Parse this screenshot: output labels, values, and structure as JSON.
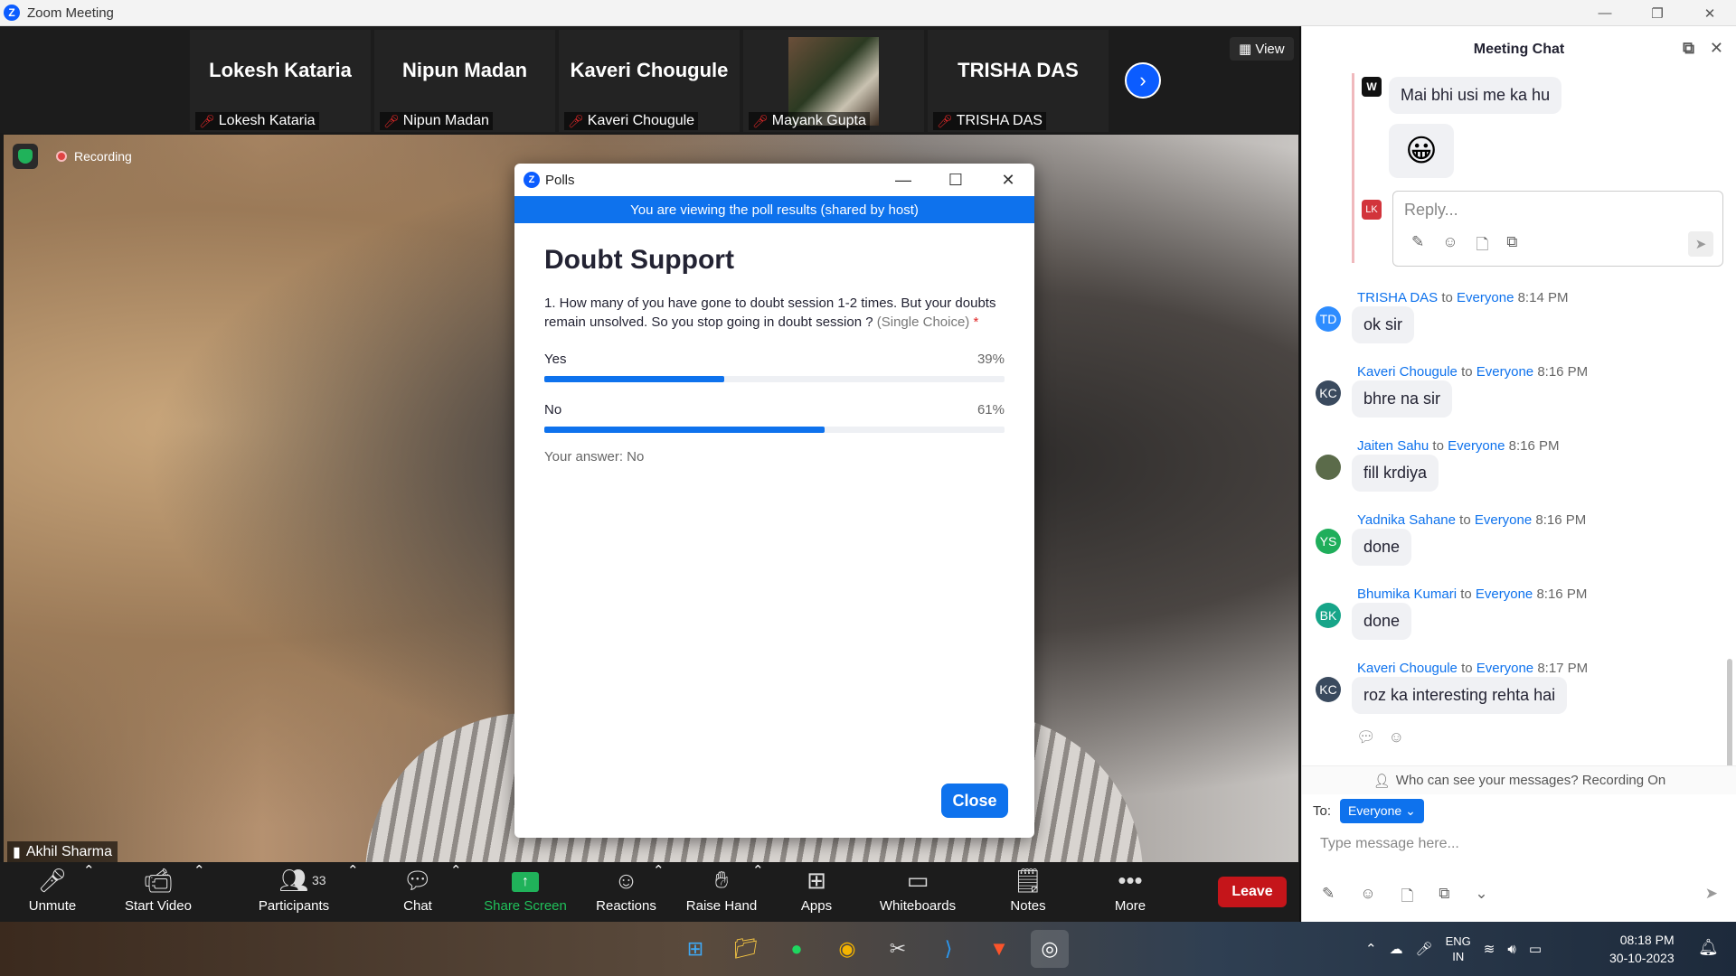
{
  "window": {
    "title": "Zoom Meeting"
  },
  "participants_strip": [
    {
      "big_name": "Lokesh Kataria",
      "label": "Lokesh Kataria"
    },
    {
      "big_name": "Nipun Madan",
      "label": "Nipun Madan"
    },
    {
      "big_name": "Kaveri Chougule",
      "label": "Kaveri Chougule"
    },
    {
      "big_name": "",
      "label": "Mayank Gupta"
    },
    {
      "big_name": "TRISHA DAS",
      "label": "TRISHA DAS"
    }
  ],
  "view_label": "View",
  "video": {
    "recording_label": "Recording",
    "speaker": "Akhil Sharma"
  },
  "toolbar": {
    "unmute": "Unmute",
    "start_video": "Start Video",
    "participants": "Participants",
    "participants_count": "33",
    "chat": "Chat",
    "share_screen": "Share Screen",
    "reactions": "Reactions",
    "raise_hand": "Raise Hand",
    "apps": "Apps",
    "whiteboards": "Whiteboards",
    "notes": "Notes",
    "more": "More",
    "leave": "Leave"
  },
  "poll": {
    "window_title": "Polls",
    "banner": "You are viewing the poll results (shared by host)",
    "heading": "Doubt Support",
    "question": "1. How many of you have gone to doubt session 1-2 times. But your doubts remain unsolved. So you stop going in doubt session ?",
    "question_hint": "(Single Choice)",
    "required_mark": "*",
    "options": [
      {
        "label": "Yes",
        "percent_text": "39%",
        "percent": 39
      },
      {
        "label": "No",
        "percent_text": "61%",
        "percent": 61
      }
    ],
    "your_answer": "Your answer: No",
    "close_button": "Close"
  },
  "chat": {
    "title": "Meeting Chat",
    "thread": {
      "avatar": "W",
      "message": "Mai bhi usi me ka hu",
      "emoji": "😀",
      "reply_avatar": "LK",
      "reply_placeholder": "Reply..."
    },
    "messages": [
      {
        "initials": "TD",
        "color": "#2d8cff",
        "sender": "TRISHA DAS",
        "to": "Everyone",
        "time": "8:14 PM",
        "text": "ok sir"
      },
      {
        "initials": "KC",
        "color": "#3a4a5e",
        "sender": "Kaveri Chougule",
        "to": "Everyone",
        "time": "8:16 PM",
        "text": "bhre na sir"
      },
      {
        "initials": "",
        "color": "#5b6b4a",
        "sender": "Jaiten Sahu",
        "to": "Everyone",
        "time": "8:16 PM",
        "text": "fill krdiya"
      },
      {
        "initials": "YS",
        "color": "#1fae5b",
        "sender": "Yadnika Sahane",
        "to": "Everyone",
        "time": "8:16 PM",
        "text": "done"
      },
      {
        "initials": "BK",
        "color": "#17a589",
        "sender": "Bhumika Kumari",
        "to": "Everyone",
        "time": "8:16 PM",
        "text": "done"
      },
      {
        "initials": "KC",
        "color": "#3a4a5e",
        "sender": "Kaveri Chougule",
        "to": "Everyone",
        "time": "8:17 PM",
        "text": "roz ka interesting rehta hai"
      }
    ],
    "to_word": "to",
    "visibility_note": "Who can see your messages? Recording On",
    "to_label": "To:",
    "to_value": "Everyone",
    "input_placeholder": "Type message here..."
  },
  "taskbar": {
    "lang_line1": "ENG",
    "lang_line2": "IN",
    "time": "08:18 PM",
    "date": "30-10-2023"
  }
}
